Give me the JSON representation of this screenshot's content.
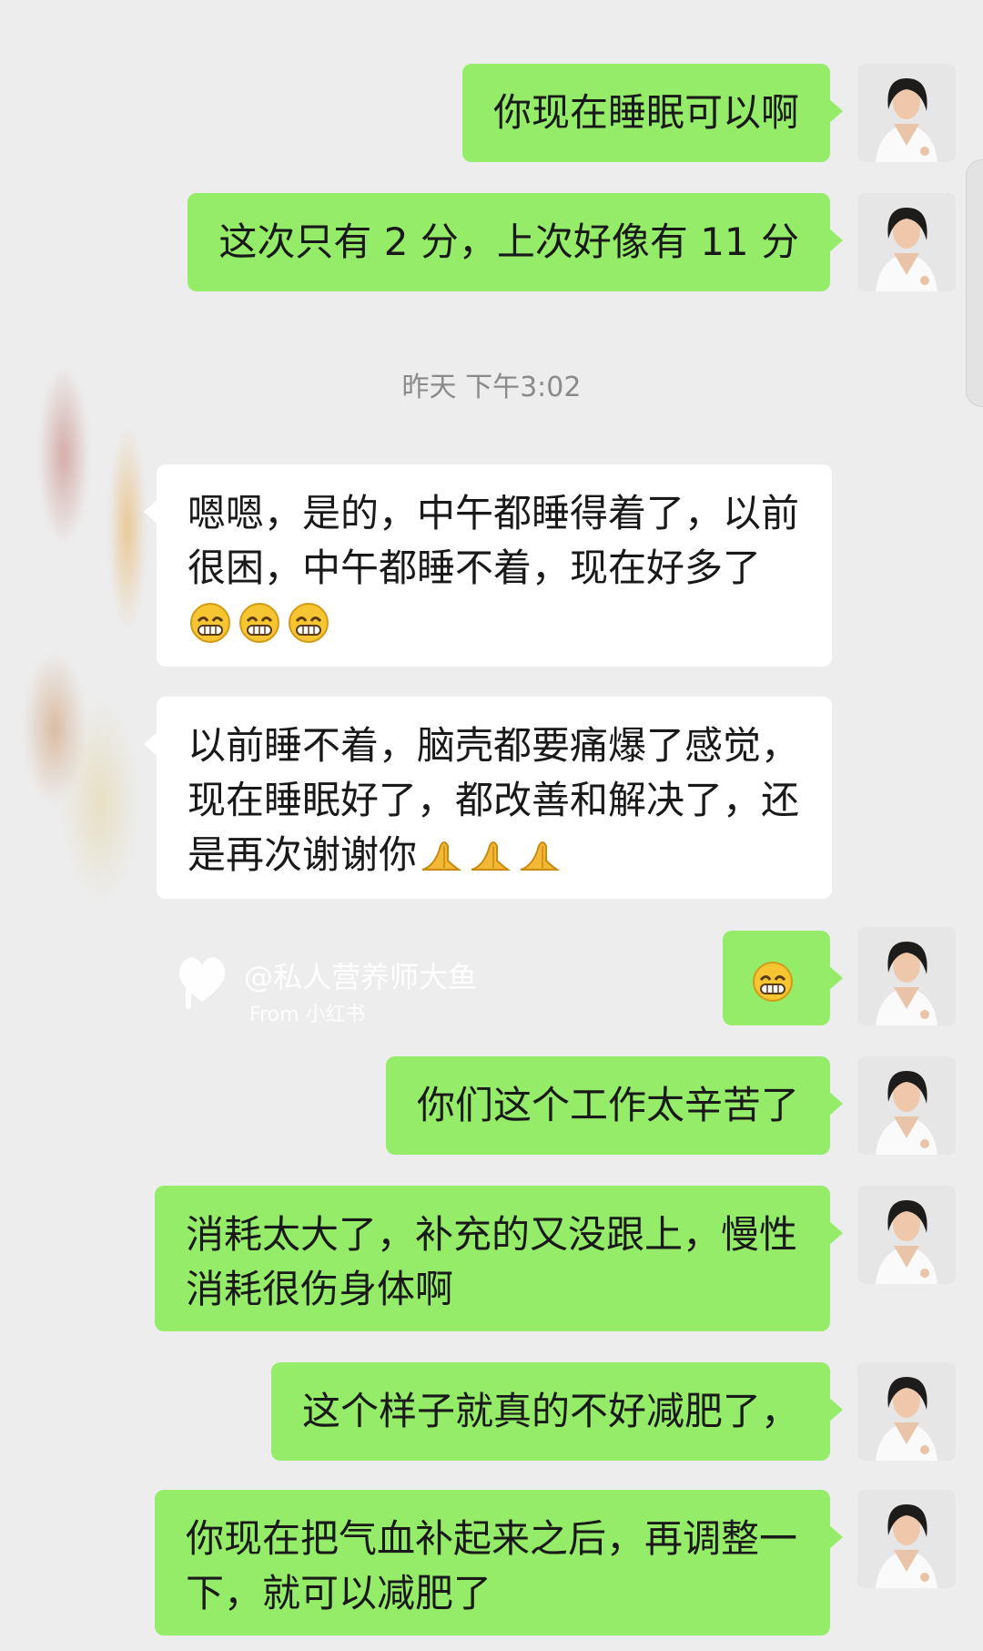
{
  "messages": [
    {
      "text": "你现在睡眠可以啊"
    },
    {
      "text": "这次只有 2 分，上次好像有 11 分"
    },
    {
      "timestamp": "昨天 下午3:02"
    },
    {
      "text": "嗯嗯，是的，中午都睡得着了，以前很困，中午都睡不着，现在好多了"
    },
    {
      "text": "以前睡不着，脑壳都要痛爆了感觉，现在睡眠好了，都改善和解决了，还是再次谢谢你"
    },
    {
      "text": "你们这个工作太辛苦了"
    },
    {
      "text": "消耗太大了，补充的又没跟上，慢性消耗很伤身体啊"
    },
    {
      "text": "这个样子就真的不好减肥了，"
    },
    {
      "text": "你现在把气血补起来之后，再调整一下，就可以减肥了"
    }
  ],
  "watermark": {
    "handle": "@私人营养师大鱼",
    "from": "From 小红书"
  },
  "icons": {
    "grin": "grinning-face-icon",
    "pray": "folded-hands-icon"
  },
  "colors": {
    "self_bubble": "#95ec69",
    "other_bubble": "#ffffff",
    "background": "#ededed"
  }
}
